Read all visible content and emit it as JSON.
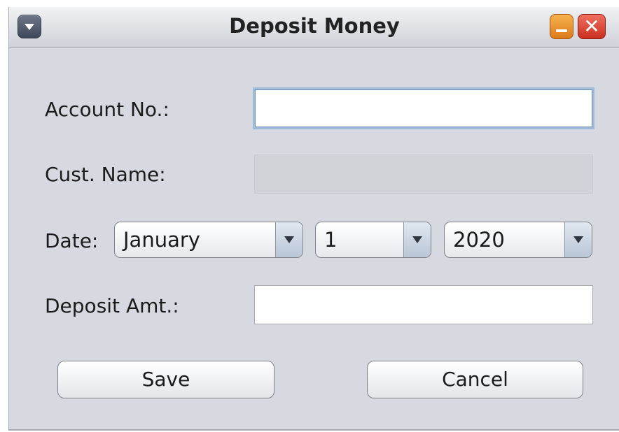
{
  "window": {
    "title": "Deposit Money"
  },
  "form": {
    "account_label": "Account No.:",
    "account_value": "",
    "name_label": "Cust. Name:",
    "name_value": "",
    "date_label": "Date:",
    "month_value": "January",
    "day_value": "1",
    "year_value": "2020",
    "amount_label": "Deposit Amt.:",
    "amount_value": ""
  },
  "buttons": {
    "save_label": "Save",
    "cancel_label": "Cancel"
  },
  "icons": {
    "menu": "window-menu-icon",
    "minimize": "minimize-icon",
    "close": "close-icon",
    "dropdown": "chevron-down-icon"
  },
  "colors": {
    "window_bg": "#d6d9df",
    "focus_ring": "#9fbbd8",
    "minimize": "#e8952f",
    "close": "#e0503e"
  }
}
